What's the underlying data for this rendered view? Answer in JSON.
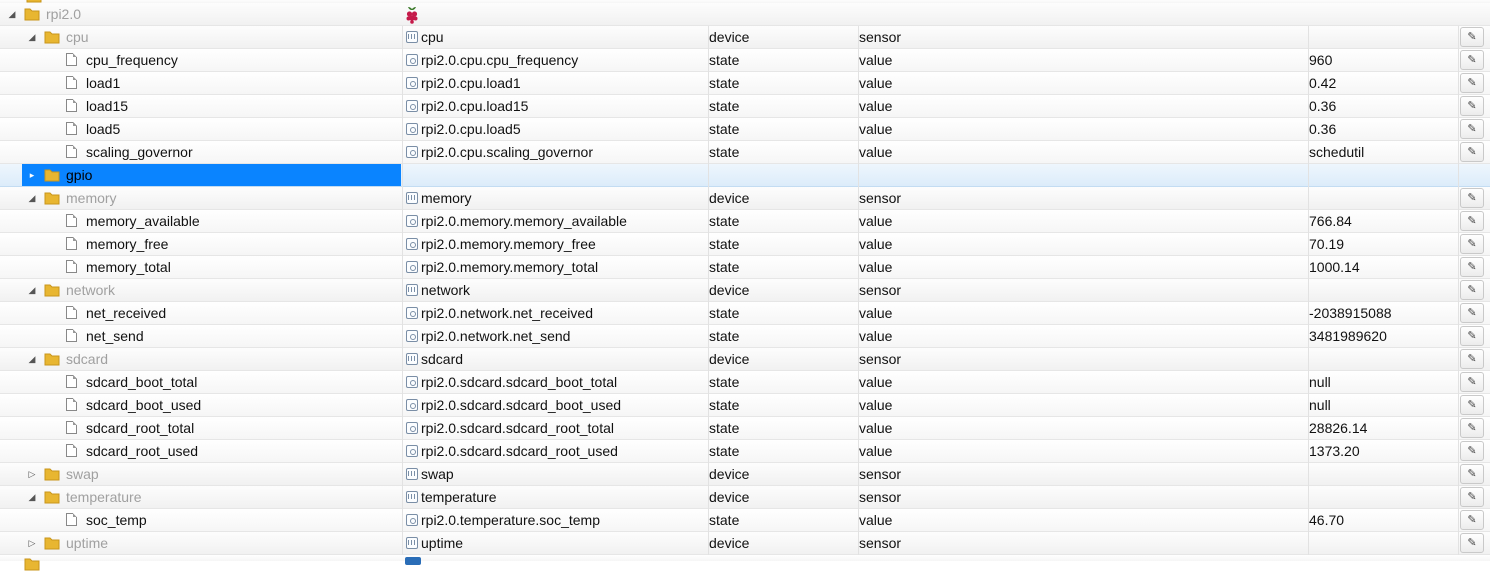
{
  "colors": {
    "selection": "#0a84ff",
    "folder": "#e8b631",
    "greyed_text": "#a0a0a0"
  },
  "root": {
    "name": "rpi2.0",
    "icon": "raspberry-logo-icon"
  },
  "rows": [
    {
      "level": 1,
      "kind": "folder",
      "expand": "open",
      "name": "cpu",
      "id": "cpu",
      "type": "device",
      "role": "sensor",
      "value": ""
    },
    {
      "level": 2,
      "kind": "file",
      "name": "cpu_frequency",
      "id": "rpi2.0.cpu.cpu_frequency",
      "type": "state",
      "role": "value",
      "value": "960"
    },
    {
      "level": 2,
      "kind": "file",
      "name": "load1",
      "id": "rpi2.0.cpu.load1",
      "type": "state",
      "role": "value",
      "value": "0.42"
    },
    {
      "level": 2,
      "kind": "file",
      "name": "load15",
      "id": "rpi2.0.cpu.load15",
      "type": "state",
      "role": "value",
      "value": "0.36"
    },
    {
      "level": 2,
      "kind": "file",
      "name": "load5",
      "id": "rpi2.0.cpu.load5",
      "type": "state",
      "role": "value",
      "value": "0.36"
    },
    {
      "level": 2,
      "kind": "file",
      "name": "scaling_governor",
      "id": "rpi2.0.cpu.scaling_governor",
      "type": "state",
      "role": "value",
      "value": "schedutil"
    },
    {
      "level": 1,
      "kind": "folder",
      "expand": "closed",
      "name": "gpio",
      "id": "",
      "type": "",
      "role": "",
      "value": "",
      "selected": true
    },
    {
      "level": 1,
      "kind": "folder",
      "expand": "open",
      "name": "memory",
      "id": "memory",
      "type": "device",
      "role": "sensor",
      "value": ""
    },
    {
      "level": 2,
      "kind": "file",
      "name": "memory_available",
      "id": "rpi2.0.memory.memory_available",
      "type": "state",
      "role": "value",
      "value": "766.84"
    },
    {
      "level": 2,
      "kind": "file",
      "name": "memory_free",
      "id": "rpi2.0.memory.memory_free",
      "type": "state",
      "role": "value",
      "value": "70.19"
    },
    {
      "level": 2,
      "kind": "file",
      "name": "memory_total",
      "id": "rpi2.0.memory.memory_total",
      "type": "state",
      "role": "value",
      "value": "1000.14"
    },
    {
      "level": 1,
      "kind": "folder",
      "expand": "open",
      "name": "network",
      "id": "network",
      "type": "device",
      "role": "sensor",
      "value": ""
    },
    {
      "level": 2,
      "kind": "file",
      "name": "net_received",
      "id": "rpi2.0.network.net_received",
      "type": "state",
      "role": "value",
      "value": "-2038915088"
    },
    {
      "level": 2,
      "kind": "file",
      "name": "net_send",
      "id": "rpi2.0.network.net_send",
      "type": "state",
      "role": "value",
      "value": "3481989620"
    },
    {
      "level": 1,
      "kind": "folder",
      "expand": "open",
      "name": "sdcard",
      "id": "sdcard",
      "type": "device",
      "role": "sensor",
      "value": ""
    },
    {
      "level": 2,
      "kind": "file",
      "name": "sdcard_boot_total",
      "id": "rpi2.0.sdcard.sdcard_boot_total",
      "type": "state",
      "role": "value",
      "value": "null"
    },
    {
      "level": 2,
      "kind": "file",
      "name": "sdcard_boot_used",
      "id": "rpi2.0.sdcard.sdcard_boot_used",
      "type": "state",
      "role": "value",
      "value": "null"
    },
    {
      "level": 2,
      "kind": "file",
      "name": "sdcard_root_total",
      "id": "rpi2.0.sdcard.sdcard_root_total",
      "type": "state",
      "role": "value",
      "value": "28826.14"
    },
    {
      "level": 2,
      "kind": "file",
      "name": "sdcard_root_used",
      "id": "rpi2.0.sdcard.sdcard_root_used",
      "type": "state",
      "role": "value",
      "value": "1373.20"
    },
    {
      "level": 1,
      "kind": "folder",
      "expand": "closed",
      "name": "swap",
      "id": "swap",
      "type": "device",
      "role": "sensor",
      "value": ""
    },
    {
      "level": 1,
      "kind": "folder",
      "expand": "open",
      "name": "temperature",
      "id": "temperature",
      "type": "device",
      "role": "sensor",
      "value": ""
    },
    {
      "level": 2,
      "kind": "file",
      "name": "soc_temp",
      "id": "rpi2.0.temperature.soc_temp",
      "type": "state",
      "role": "value",
      "value": "46.70"
    },
    {
      "level": 1,
      "kind": "folder",
      "expand": "closed",
      "name": "uptime",
      "id": "uptime",
      "type": "device",
      "role": "sensor",
      "value": ""
    }
  ]
}
